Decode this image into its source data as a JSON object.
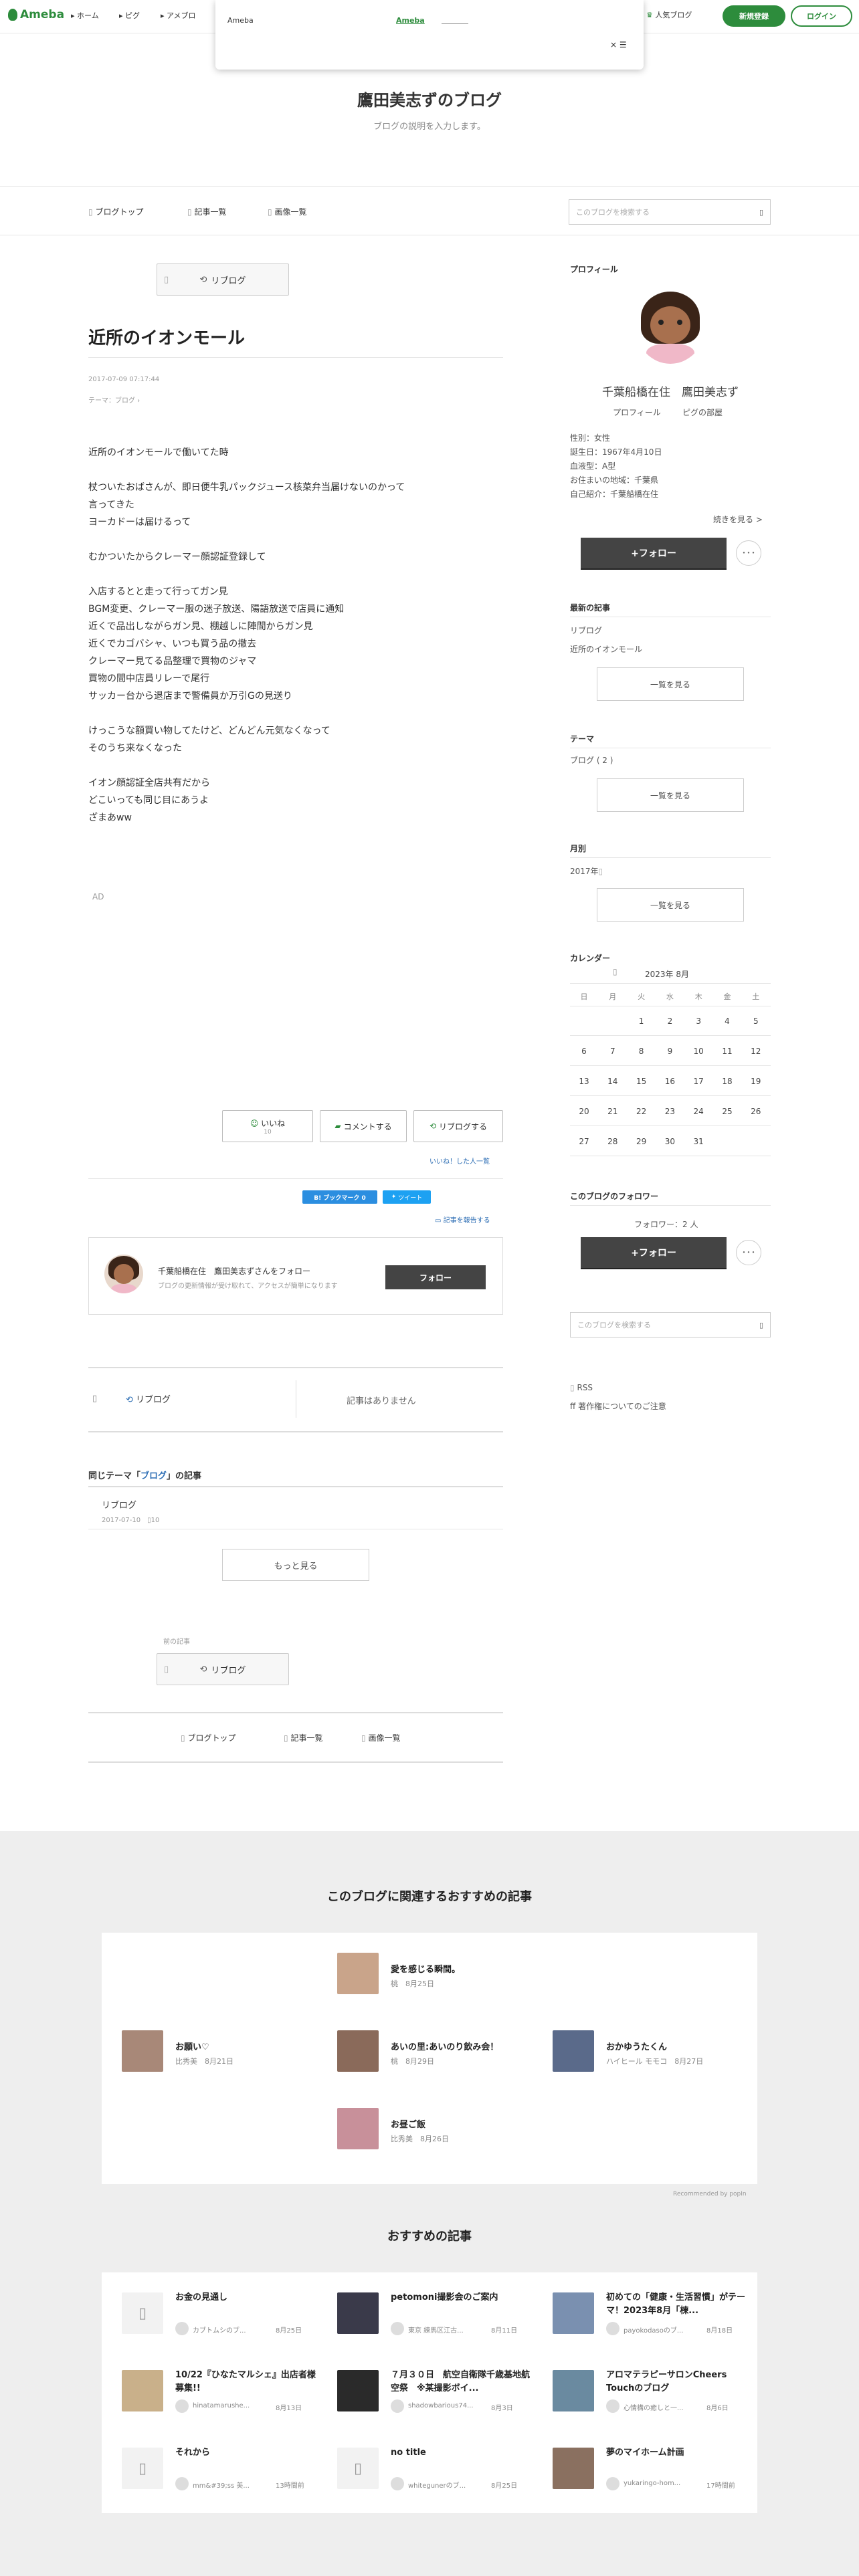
{
  "globalbar": {
    "logo": "Ameba",
    "nav": [
      "ホーム",
      "ピグ",
      "アメブロ"
    ],
    "popular": "人気ブログ",
    "signup": "新規登録",
    "login": "ログイン"
  },
  "popup": {
    "label": "Ameba",
    "link": "Ameba",
    "close": "× ☰"
  },
  "blog": {
    "title": "鷹田美志ずのブログ",
    "description": "ブログの説明を入力します。"
  },
  "subnav": {
    "items": [
      "ブログトップ",
      "記事一覧",
      "画像一覧"
    ],
    "search_placeholder": "このブログを検索する"
  },
  "article": {
    "reblog": "リブログ",
    "title": "近所のイオンモール",
    "date": "2017-07-09 07:17:44",
    "theme": "テーマ：ブログ",
    "body": [
      "近所のイオンモールで働いてた時",
      "",
      "杖ついたおばさんが、即日便牛乳パックジュース核菜弁当届けないのかって",
      "言ってきた",
      "ヨーカドーは届けるって",
      "",
      "むかついたからクレーマー顔認証登録して",
      "",
      "入店するとと走って行ってガン見",
      "BGM変更、クレーマー服の迷子放送、陽語放送で店員に通知",
      "近くで品出しながらガン見、棚越しに陣間からガン見",
      "近くでカゴバシャ、いつも買う品の撤去",
      "クレーマー見てる品整理で買物のジャマ",
      "買物の間中店員リレーで尾行",
      "サッカー台から退店まで警備員か万引Gの見送り",
      "",
      "けっこうな額買い物してたけど、どんどん元気なくなって",
      "そのうち来なくなった",
      "",
      "イオン顔認証全店共有だから",
      "どこいっても同じ目にあうよ",
      "ざまあww"
    ],
    "ad": "AD",
    "like": "いいね",
    "like_count": "10",
    "comment": "コメントする",
    "reblog_action": "リブログする",
    "liked_by": "いいね！した人一覧",
    "bookmark": "B! ブックマーク 0",
    "tweet": "ツイート",
    "report": "記事を報告する"
  },
  "follow_card": {
    "text": "千葉船橋在住　鷹田美志ずさんをフォロー",
    "sub": "ブログの更新情報が受け取れて、アクセスが簡単になります",
    "button": "フォロー"
  },
  "reblog_box": {
    "label": "リブログ",
    "none": "記事はありません"
  },
  "same_theme": {
    "heading_prefix": "同じテーマ「",
    "heading_link": "ブログ",
    "heading_suffix": "」の記事",
    "item_title": "リブログ",
    "item_date": "2017-07-10",
    "item_count": "10",
    "more": "もっと見る"
  },
  "prev": {
    "label": "前の記事",
    "reblog": "リブログ"
  },
  "footer_nav": [
    "ブログトップ",
    "記事一覧",
    "画像一覧"
  ],
  "sidebar": {
    "profile_h": "プロフィール",
    "name": "千葉船橋在住　鷹田美志ず",
    "profile_link": "プロフィール",
    "pig_link": "ピグの部屋",
    "details": [
      "性別：女性",
      "誕生日：1967年4月10日",
      "血液型：A型",
      "お住まいの地域：千葉県",
      "自己紹介：千葉船橋在住"
    ],
    "read_more": "続きを見る >",
    "follow": "+フォロー",
    "more_dots": "･･･",
    "recent_h": "最新の記事",
    "recent": [
      "リブログ",
      "近所のイオンモール"
    ],
    "list_btn": "一覧を見る",
    "theme_h": "テーマ",
    "theme_item": "ブログ ( 2 )",
    "monthly_h": "月別",
    "monthly_item": "2017年",
    "calendar_h": "カレンダー",
    "cal_month": "2023年 8月",
    "weekdays": [
      "日",
      "月",
      "火",
      "水",
      "木",
      "金",
      "土"
    ],
    "weeks": [
      [
        "",
        "",
        "1",
        "2",
        "3",
        "4",
        "5"
      ],
      [
        "6",
        "7",
        "8",
        "9",
        "10",
        "11",
        "12"
      ],
      [
        "13",
        "14",
        "15",
        "16",
        "17",
        "18",
        "19"
      ],
      [
        "20",
        "21",
        "22",
        "23",
        "24",
        "25",
        "26"
      ],
      [
        "27",
        "28",
        "29",
        "30",
        "31",
        "",
        ""
      ]
    ],
    "followers_h": "このブログのフォロワー",
    "followers_count": "フォロワー：2 人",
    "rss": "RSS",
    "copyright": "著作権についてのご注意"
  },
  "related": {
    "heading": "このブログに関連するおすすめの記事",
    "items": [
      {
        "title": "愛を感じる瞬間。",
        "author": "桃",
        "date": "8月25日"
      },
      {
        "title": "お願い♡",
        "author": "比秀美",
        "date": "8月21日"
      },
      {
        "title": "あいの里:あいのり飲み会！",
        "author": "桃",
        "date": "8月29日"
      },
      {
        "title": "おかゆうたくん",
        "author": "ハイヒール モモコ",
        "date": "8月27日"
      },
      {
        "title": "お昼ご飯",
        "author": "比秀美",
        "date": "8月26日"
      }
    ],
    "recommended_by": "Recommended by popIn"
  },
  "recommended": {
    "heading": "おすすめの記事",
    "items": [
      {
        "title": "お金の見通し",
        "author": "カブトムシのブ...",
        "date": "8月25日"
      },
      {
        "title": "petomoni撮影会のご案内",
        "author": "東京 練馬区江古...",
        "date": "8月11日"
      },
      {
        "title": "初めての「健康・生活習慣」がテーマ！2023年8月「棟...",
        "author": "payokodasoのブ...",
        "date": "8月18日"
      },
      {
        "title": "10/22『ひなたマルシェ』出店者様募集!!",
        "author": "hinatamarushe...",
        "date": "8月13日"
      },
      {
        "title": "７月３０日　航空自衛隊千歳基地航空祭　※某撮影ボイ...",
        "author": "shadowbarious74...",
        "date": "8月3日"
      },
      {
        "title": "アロマテラピーサロンCheers Touchのブログ",
        "author": "心情構の癒しと一...",
        "date": "8月6日"
      },
      {
        "title": "それから",
        "author": "mm&#39;ss 美...",
        "date": "13時間前"
      },
      {
        "title": "no title",
        "author": "whitegunerのブ...",
        "date": "8月25日"
      },
      {
        "title": "夢のマイホーム計画",
        "author": "yukaringo-hom...",
        "date": "17時間前"
      }
    ]
  }
}
